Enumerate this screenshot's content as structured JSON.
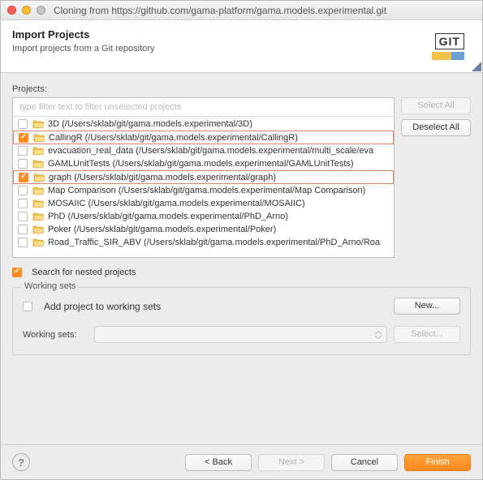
{
  "window": {
    "title": "Cloning from https://github.com/gama-platform/gama.models.experimental.git"
  },
  "header": {
    "title": "Import Projects",
    "subtitle": "Import projects from a Git repository",
    "badge": "GIT"
  },
  "projects": {
    "label": "Projects:",
    "filter_placeholder": "type filter text to filter unselected projects",
    "items": [
      {
        "checked": false,
        "highlight": false,
        "label": "3D (/Users/sklab/git/gama.models.experimental/3D)"
      },
      {
        "checked": true,
        "highlight": true,
        "label": "CallingR (/Users/sklab/git/gama.models.experimental/CallingR)"
      },
      {
        "checked": false,
        "highlight": false,
        "label": "evacuation_real_data (/Users/sklab/git/gama.models.experimental/multi_scale/eva"
      },
      {
        "checked": false,
        "highlight": false,
        "label": "GAMLUnitTests (/Users/sklab/git/gama.models.experimental/GAMLUnitTests)"
      },
      {
        "checked": true,
        "highlight": true,
        "label": "graph (/Users/sklab/git/gama.models.experimental/graph)"
      },
      {
        "checked": false,
        "highlight": false,
        "label": "Map Comparison (/Users/sklab/git/gama.models.experimental/Map Comparison)"
      },
      {
        "checked": false,
        "highlight": false,
        "label": "MOSAIIC (/Users/sklab/git/gama.models.experimental/MOSAIIC)"
      },
      {
        "checked": false,
        "highlight": false,
        "label": "PhD (/Users/sklab/git/gama.models.experimental/PhD_Arno)"
      },
      {
        "checked": false,
        "highlight": false,
        "label": "Poker (/Users/sklab/git/gama.models.experimental/Poker)"
      },
      {
        "checked": false,
        "highlight": false,
        "label": "Road_Traffic_SIR_ABV (/Users/sklab/git/gama.models.experimental/PhD_Arno/Roa"
      }
    ]
  },
  "buttons": {
    "select_all": "Select All",
    "deselect_all": "Deselect All",
    "new": "New...",
    "select": "Select..."
  },
  "nested": {
    "checked": true,
    "label": "Search for nested projects"
  },
  "working_sets": {
    "legend": "Working sets",
    "add_checked": false,
    "add_label": "Add project to working sets",
    "combo_label": "Working sets:"
  },
  "footer": {
    "back": "< Back",
    "next": "Next >",
    "cancel": "Cancel",
    "finish": "Finish"
  }
}
